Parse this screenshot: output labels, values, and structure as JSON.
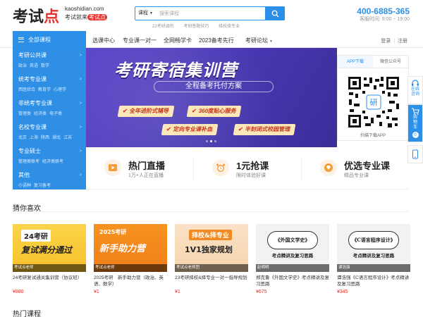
{
  "header": {
    "logo_main": "考试",
    "logo_accent": "点",
    "logo_domain": "kaoshidian.com",
    "logo_slogan_pre": "考试就来",
    "logo_slogan_hl": "考试点",
    "search": {
      "category": "课程",
      "placeholder": "搜索课程",
      "hot_links": [
        "22考研调剂",
        "考研答题技巧",
        "择校择专业"
      ]
    },
    "phone": "400-6885-365",
    "hours": "客服时间: 9:00 ~ 19:00"
  },
  "nav": {
    "all_courses": "全部课程",
    "items": [
      "选课中心",
      "专业课一对一",
      "全网畅学卡",
      "2023备考先行",
      "考研论坛"
    ],
    "login": "登录",
    "register": "注册",
    "separator": "|"
  },
  "categories": [
    {
      "title": "考研公共课",
      "subs": [
        "政治",
        "英语",
        "数学"
      ]
    },
    {
      "title": "统考专业课",
      "subs": [
        "西医综合",
        "教育学",
        "心理学"
      ]
    },
    {
      "title": "非统考专业课",
      "subs": [
        "管理类",
        "经济类",
        "电子类"
      ]
    },
    {
      "title": "名校专业课",
      "subs": [
        "北京",
        "上海",
        "陕西",
        "湖北",
        "江苏"
      ]
    },
    {
      "title": "专业硕士",
      "subs": [
        "管理类联考",
        "经济类联考"
      ]
    },
    {
      "title": "其他",
      "subs": [
        "小语种",
        "复习备考"
      ]
    }
  ],
  "banner": {
    "title": "考研寄宿集训营",
    "subtitle": "全程备考托付方案",
    "tags": [
      "全年进阶式辅导",
      "360度贴心服务",
      "定向专业课补血",
      "半封闭式校园管理"
    ]
  },
  "app_panel": {
    "tabs": [
      "APP下载",
      "微信公众号"
    ],
    "qr_center": "研",
    "caption": "扫描下载APP"
  },
  "features": [
    {
      "title": "热门直播",
      "sub": "1万+人正在直播",
      "icon": "play-icon"
    },
    {
      "title": "1元抢课",
      "sub": "限时体验好课",
      "icon": "alarm-clock-icon"
    },
    {
      "title": "优选专业课",
      "sub": "精品专业课",
      "icon": "diamond-icon"
    }
  ],
  "float_bar": {
    "consult": "在线咨询",
    "cart": "购物车",
    "cart_count": "0"
  },
  "sections": {
    "guess": "猜你喜欢",
    "hot": "热门课程"
  },
  "courses": [
    {
      "thumb_line1": "24考研",
      "thumb_line2": "复试满分通过",
      "badge": "考试点老师",
      "name": "24考研复试通关集训营（协议班）",
      "price": "¥880"
    },
    {
      "thumb_line1": "2025考研",
      "thumb_line2": "新手助力营",
      "badge": "考试点老师",
      "name": "2025考研　新手助力营（政治、英语、数学）",
      "price": "¥1"
    },
    {
      "thumb_line1": "择校&择专业",
      "thumb_line2": "1V1独家规划",
      "badge": "考试点老师团",
      "name": "23考研择校&择专业一对一指导规划",
      "price": "¥1"
    },
    {
      "book": "《外国文学史》",
      "book_sub": "考点精讲及复习思路",
      "badge": "赵明明",
      "name": "郑克鲁《外国文学史》考点精讲及复习思路",
      "price": "¥675"
    },
    {
      "book": "《C语言程序设计》",
      "book_sub": "考点精讲及复习思路",
      "badge": "谭浩强",
      "name": "谭浩强《C语言程序设计》考点精讲及复习思路",
      "price": "¥345"
    }
  ],
  "colors": {
    "brand_blue": "#2c8fe8",
    "brand_red": "#e8302a",
    "banner_purple": "#4b3ab8",
    "tag_bg": "#fbe7b9"
  }
}
